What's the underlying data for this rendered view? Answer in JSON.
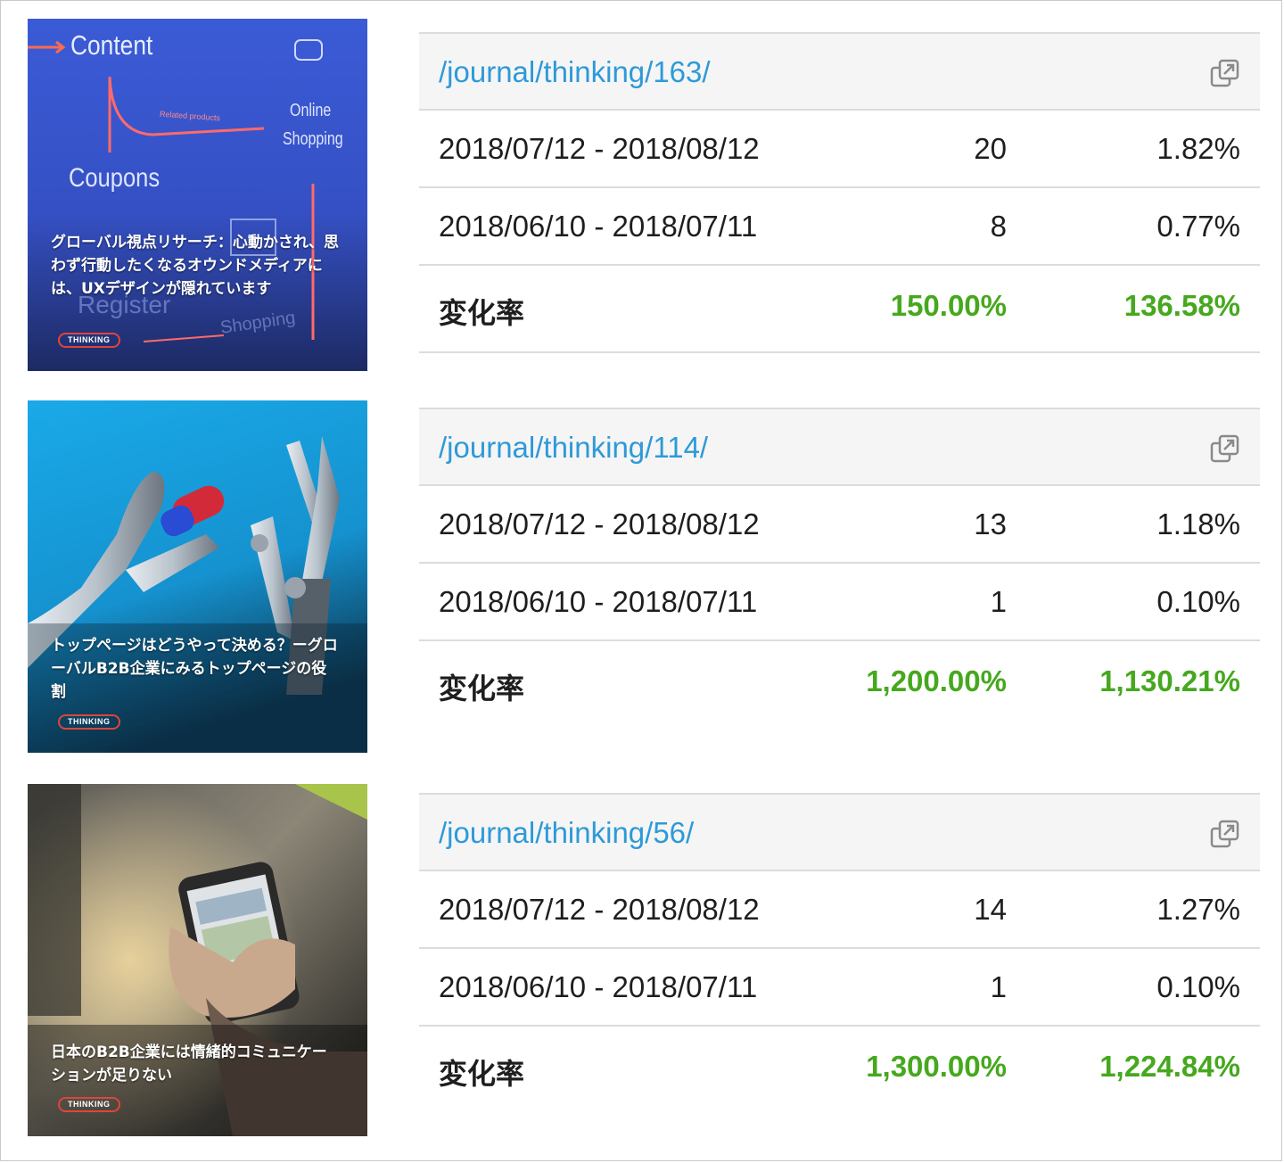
{
  "entries": [
    {
      "thumb": {
        "title": "グローバル視点リサーチ：心動かされ、思わず行動したくなるオウンドメディアには、UXデザインが隠れています",
        "tag": "THINKING",
        "scene_words": [
          "Content",
          "Coupons",
          "Online",
          "Shopping",
          "Related products",
          "Register",
          "Shopping"
        ]
      },
      "url": "/journal/thinking/163/",
      "rows": [
        {
          "period": "2018/07/12 - 2018/08/12",
          "count": "20",
          "rate": "1.82%"
        },
        {
          "period": "2018/06/10 - 2018/07/11",
          "count": "8",
          "rate": "0.77%"
        }
      ],
      "change": {
        "label": "変化率",
        "count": "150.00%",
        "rate": "136.58%"
      }
    },
    {
      "thumb": {
        "title": "トップページはどうやって決める？ーグローバルB2B企業にみるトップページの役割",
        "tag": "THINKING"
      },
      "url": "/journal/thinking/114/",
      "rows": [
        {
          "period": "2018/07/12 - 2018/08/12",
          "count": "13",
          "rate": "1.18%"
        },
        {
          "period": "2018/06/10 - 2018/07/11",
          "count": "1",
          "rate": "0.10%"
        }
      ],
      "change": {
        "label": "変化率",
        "count": "1,200.00%",
        "rate": "1,130.21%"
      }
    },
    {
      "thumb": {
        "title": "日本のB2B企業には情緒的コミュニケーションが足りない",
        "tag": "THINKING"
      },
      "url": "/journal/thinking/56/",
      "rows": [
        {
          "period": "2018/07/12 - 2018/08/12",
          "count": "14",
          "rate": "1.27%"
        },
        {
          "period": "2018/06/10 - 2018/07/11",
          "count": "1",
          "rate": "0.10%"
        }
      ],
      "change": {
        "label": "変化率",
        "count": "1,300.00%",
        "rate": "1,224.84%"
      }
    }
  ],
  "colors": {
    "link": "#2e9ad8",
    "positive": "#46a81e",
    "tag_border": "#e0453a"
  },
  "icons": {
    "open_external": "external-link-icon"
  }
}
